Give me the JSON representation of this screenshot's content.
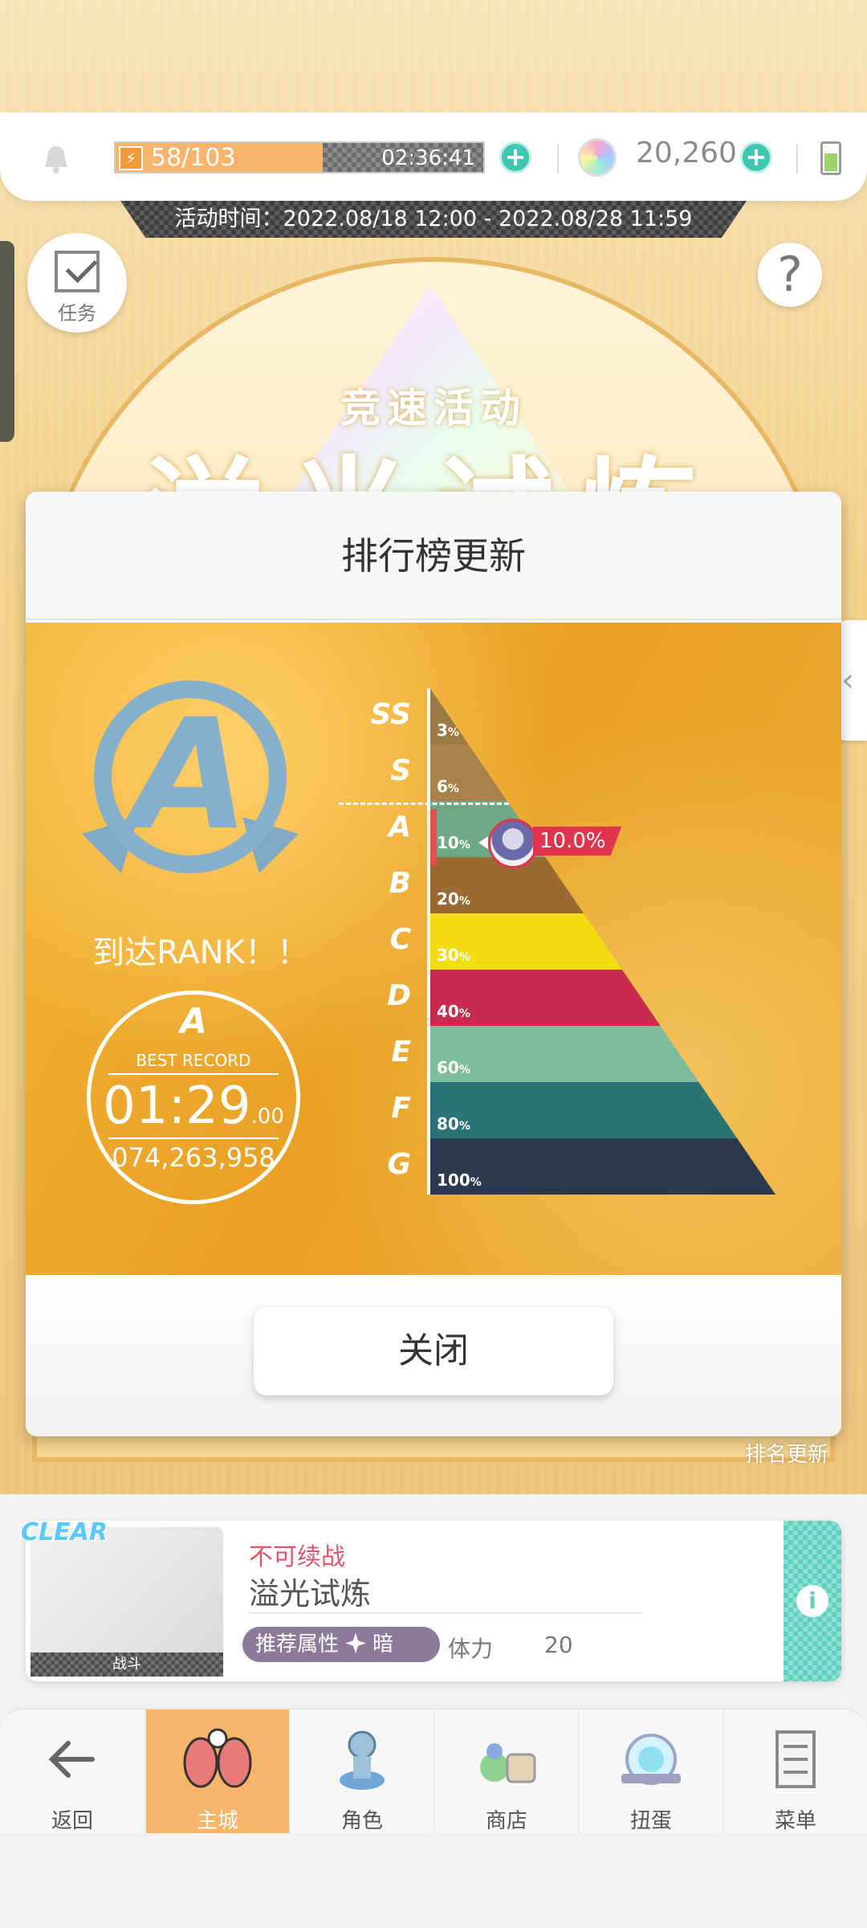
{
  "status_bar": {
    "stamina_text": "58/103",
    "stamina_progress": 0.563,
    "stamina_timer": "02:36:41",
    "gem_count": "20,260",
    "icons": [
      "bell-icon",
      "lightning-icon",
      "plus-icon",
      "gem-icon",
      "battery-icon"
    ]
  },
  "event": {
    "time_banner": "活动时间：2022.08/18 12:00 - 2022.08/28 11:59",
    "subtitle": "竞速活动",
    "title": "溢光试炼"
  },
  "side_buttons": {
    "task_label": "任务",
    "help_symbol": "?"
  },
  "modal": {
    "title": "排行榜更新",
    "close_label": "关闭",
    "rank_badge_letter": "A",
    "rank_reached_text": "到达RANK！！",
    "record": {
      "rank": "A",
      "label": "BEST RECORD",
      "time_main": "01:29",
      "time_fraction": ".00",
      "score": "074,263,958"
    },
    "marker_value": "10.0%"
  },
  "chart_data": {
    "type": "bar",
    "title": "",
    "categories": [
      "SS",
      "S",
      "A",
      "B",
      "C",
      "D",
      "E",
      "F",
      "G"
    ],
    "values": [
      3,
      6,
      10,
      20,
      30,
      40,
      60,
      80,
      100
    ],
    "unit": "%",
    "current_rank": "A",
    "current_value": 10.0,
    "colors": [
      "#9a7a45",
      "#a98249",
      "#6fa884",
      "#9a6a33",
      "#f3dd12",
      "#c92b4e",
      "#7ebc9f",
      "#2a7478",
      "#2a3a4c"
    ]
  },
  "rank_update_caption": "排名更新",
  "stage": {
    "clear_badge": "CLEAR",
    "thumb_label": "战斗",
    "status": "不可续战",
    "name": "溢光试炼",
    "attr_label": "推荐属性",
    "attr_value": "暗",
    "stamina_label": "体力",
    "stamina_cost": "20",
    "info_symbol": "i"
  },
  "nav": {
    "items": [
      {
        "label": "返回",
        "icon": "back-arrow-icon"
      },
      {
        "label": "主城",
        "icon": "home-wings-icon"
      },
      {
        "label": "角色",
        "icon": "character-icon"
      },
      {
        "label": "商店",
        "icon": "shop-icon"
      },
      {
        "label": "扭蛋",
        "icon": "gacha-icon"
      },
      {
        "label": "菜单",
        "icon": "menu-icon"
      }
    ],
    "active_index": 1
  }
}
